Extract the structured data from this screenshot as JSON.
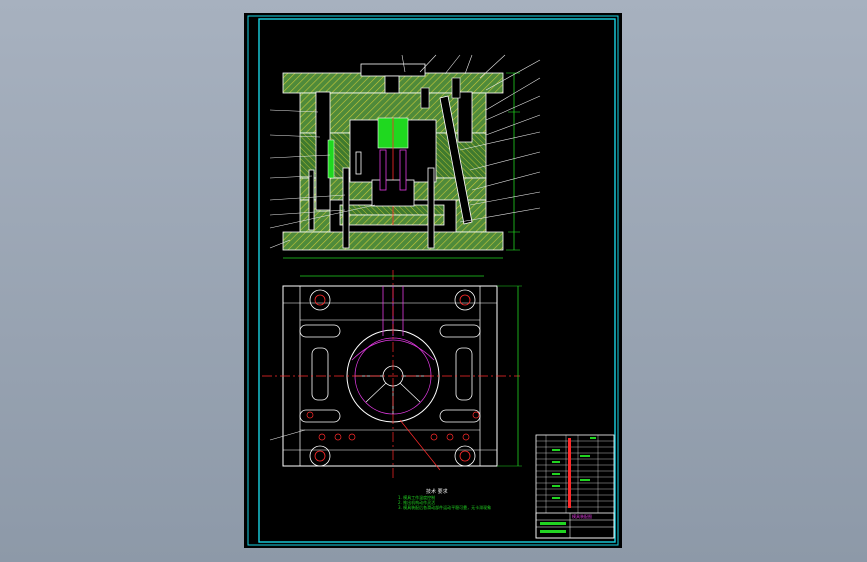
{
  "viewport": {
    "background": "#95a1b0"
  },
  "drawing": {
    "sheet_color": "#000000",
    "frame_color": "#19d3e3",
    "outline_color": "#ffffff",
    "section_fill": "#4f8a3a",
    "hatch_color": "#c9c93a",
    "dimension_color": "#21d421",
    "centerline_color": "#ff2a2a",
    "highlight_color": "#e23ae2",
    "leader_color": "#e8e8e8"
  },
  "notes": {
    "title": "技术 要求",
    "lines": [
      "1. 模具工作温度控制",
      "2. 推出机构动作灵活",
      "3. 模具装配后各滑动部件运动平稳可靠，无卡滞现象"
    ]
  },
  "title_block": {
    "header": "模具装配图"
  }
}
